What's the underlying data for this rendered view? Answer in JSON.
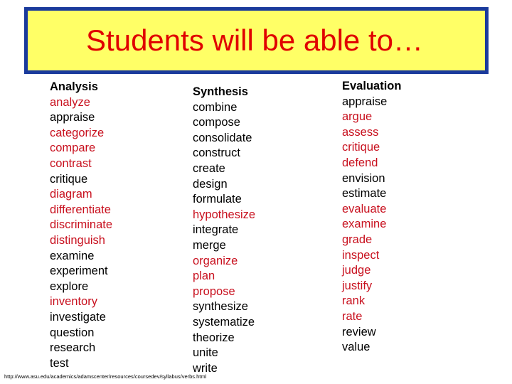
{
  "slide": {
    "title": "Students will be able to…",
    "colors": {
      "title_text": "#e00000",
      "title_box_fill": "#ffff66",
      "title_box_border": "#1a3a9c",
      "highlight_word": "#c8101e",
      "normal_word": "#000000"
    }
  },
  "columns": [
    {
      "header": "Analysis",
      "words": [
        {
          "text": "analyze",
          "highlighted": true
        },
        {
          "text": "appraise",
          "highlighted": false
        },
        {
          "text": "categorize",
          "highlighted": true
        },
        {
          "text": "compare",
          "highlighted": true
        },
        {
          "text": "contrast",
          "highlighted": true
        },
        {
          "text": "critique",
          "highlighted": false
        },
        {
          "text": "diagram",
          "highlighted": true
        },
        {
          "text": "differentiate",
          "highlighted": true
        },
        {
          "text": "discriminate",
          "highlighted": true
        },
        {
          "text": "distinguish",
          "highlighted": true
        },
        {
          "text": "examine",
          "highlighted": false
        },
        {
          "text": "experiment",
          "highlighted": false
        },
        {
          "text": "explore",
          "highlighted": false
        },
        {
          "text": "inventory",
          "highlighted": true
        },
        {
          "text": "investigate",
          "highlighted": false
        },
        {
          "text": "question",
          "highlighted": false
        },
        {
          "text": "research",
          "highlighted": false
        },
        {
          "text": "test",
          "highlighted": false
        }
      ]
    },
    {
      "header": "Synthesis",
      "words": [
        {
          "text": "combine",
          "highlighted": false
        },
        {
          "text": "compose",
          "highlighted": false
        },
        {
          "text": "consolidate",
          "highlighted": false
        },
        {
          "text": "construct",
          "highlighted": false
        },
        {
          "text": "create",
          "highlighted": false
        },
        {
          "text": "design",
          "highlighted": false
        },
        {
          "text": "formulate",
          "highlighted": false
        },
        {
          "text": "hypothesize",
          "highlighted": true
        },
        {
          "text": "integrate",
          "highlighted": false
        },
        {
          "text": "merge",
          "highlighted": false
        },
        {
          "text": "organize",
          "highlighted": true
        },
        {
          "text": "plan",
          "highlighted": true
        },
        {
          "text": "propose",
          "highlighted": true
        },
        {
          "text": "synthesize",
          "highlighted": false
        },
        {
          "text": "systematize",
          "highlighted": false
        },
        {
          "text": "theorize",
          "highlighted": false
        },
        {
          "text": "unite",
          "highlighted": false
        },
        {
          "text": "write",
          "highlighted": false
        }
      ]
    },
    {
      "header": "Evaluation",
      "words": [
        {
          "text": "appraise",
          "highlighted": false
        },
        {
          "text": "argue",
          "highlighted": true
        },
        {
          "text": "assess",
          "highlighted": true
        },
        {
          "text": "critique",
          "highlighted": true
        },
        {
          "text": "defend",
          "highlighted": true
        },
        {
          "text": "envision",
          "highlighted": false
        },
        {
          "text": "estimate",
          "highlighted": false
        },
        {
          "text": "evaluate",
          "highlighted": true
        },
        {
          "text": "examine",
          "highlighted": true
        },
        {
          "text": "grade",
          "highlighted": true
        },
        {
          "text": "inspect",
          "highlighted": true
        },
        {
          "text": "judge",
          "highlighted": true
        },
        {
          "text": "justify",
          "highlighted": true
        },
        {
          "text": "rank",
          "highlighted": true
        },
        {
          "text": "rate",
          "highlighted": true
        },
        {
          "text": "review",
          "highlighted": false
        },
        {
          "text": "value",
          "highlighted": false
        }
      ]
    }
  ],
  "source": {
    "url_text": "http://www.asu.edu/academics/adamscenter/resources/coursedev/syllabus/verbs.html"
  }
}
